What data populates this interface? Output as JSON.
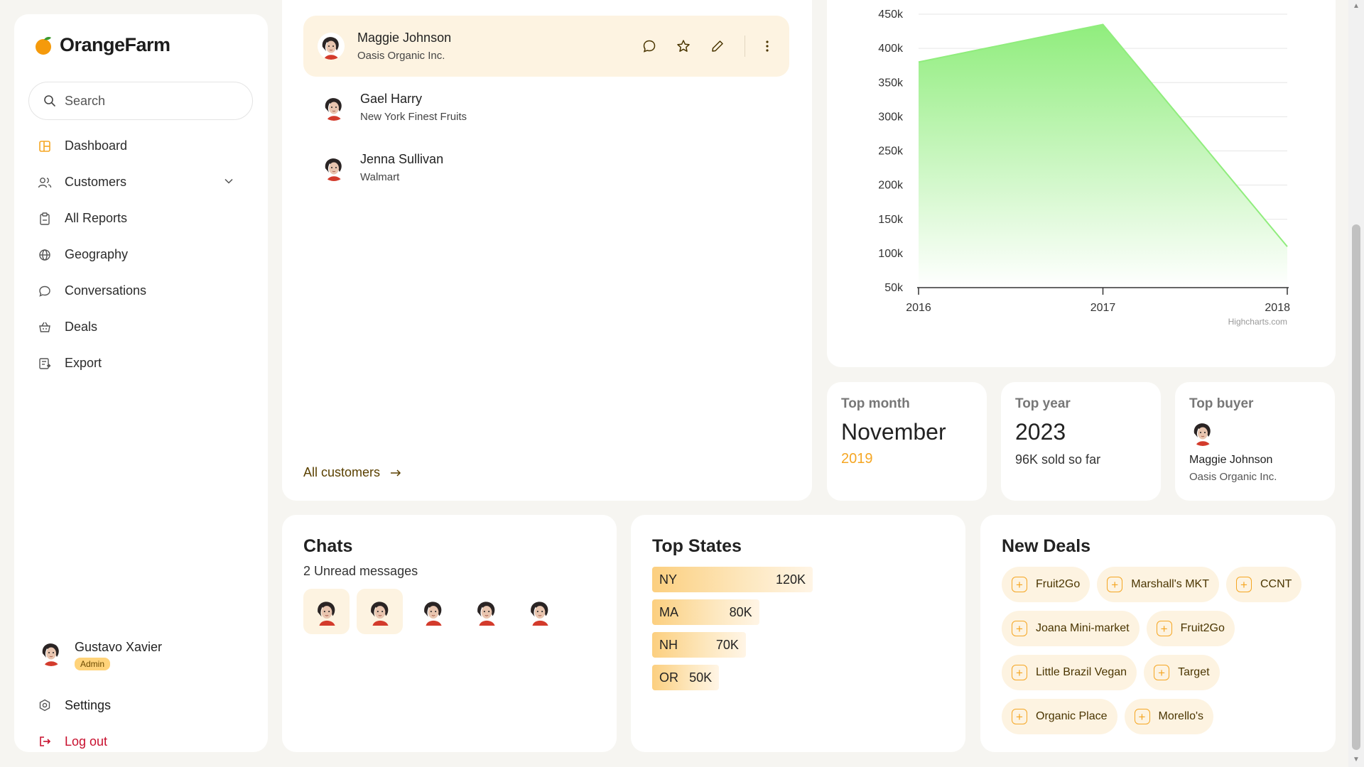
{
  "app": {
    "name": "OrangeFarm"
  },
  "search": {
    "placeholder": "Search"
  },
  "nav": {
    "items": [
      {
        "label": "Dashboard",
        "icon": "dashboard-icon"
      },
      {
        "label": "Customers",
        "icon": "users-icon"
      },
      {
        "label": "All Reports",
        "icon": "clipboard-icon"
      },
      {
        "label": "Geography",
        "icon": "globe-icon"
      },
      {
        "label": "Conversations",
        "icon": "chat-icon"
      },
      {
        "label": "Deals",
        "icon": "basket-icon"
      },
      {
        "label": "Export",
        "icon": "export-icon"
      }
    ]
  },
  "user": {
    "name": "Gustavo Xavier",
    "role": "Admin"
  },
  "bottom_nav": {
    "settings": "Settings",
    "logout": "Log out"
  },
  "customers": {
    "list": [
      {
        "name": "Maggie Johnson",
        "company": "Oasis Organic Inc."
      },
      {
        "name": "Gael Harry",
        "company": "New York Finest Fruits"
      },
      {
        "name": "Jenna Sullivan",
        "company": "Walmart"
      }
    ],
    "all_link": "All customers"
  },
  "chart_data": {
    "type": "area",
    "x": [
      "2016",
      "2017",
      "2018"
    ],
    "values": [
      380000,
      435000,
      110000
    ],
    "yticks": [
      "50k",
      "100k",
      "150k",
      "200k",
      "250k",
      "300k",
      "350k",
      "400k",
      "450k"
    ],
    "ylim": [
      50000,
      450000
    ],
    "credit": "Highcharts.com",
    "colors": {
      "fill_top": "#90ed7d",
      "fill_bottom": "#ffffff",
      "axis": "#333333",
      "grid": "#e6e6e6"
    }
  },
  "stats": {
    "top_month": {
      "label": "Top month",
      "value": "November",
      "sub": "2019"
    },
    "top_year": {
      "label": "Top year",
      "value": "2023",
      "sub": "96K sold so far"
    },
    "top_buyer": {
      "label": "Top buyer",
      "name": "Maggie Johnson",
      "company": "Oasis Organic Inc."
    }
  },
  "chats": {
    "title": "Chats",
    "unread": "2 Unread messages",
    "highlighted_count": 2,
    "avatar_count": 5
  },
  "top_states": {
    "title": "Top States",
    "rows": [
      {
        "state": "NY",
        "value": "120K",
        "amount": 120
      },
      {
        "state": "MA",
        "value": "80K",
        "amount": 80
      },
      {
        "state": "NH",
        "value": "70K",
        "amount": 70
      },
      {
        "state": "OR",
        "value": "50K",
        "amount": 50
      }
    ]
  },
  "new_deals": {
    "title": "New Deals",
    "items": [
      "Fruit2Go",
      "Marshall's MKT",
      "CCNT",
      "Joana Mini-market",
      "Fruit2Go",
      "Little Brazil Vegan",
      "Target",
      "Organic Place",
      "Morello's"
    ]
  },
  "colors": {
    "accent": "#f5a623",
    "accent_soft": "#fdf3e1",
    "logout": "#c8102e"
  }
}
